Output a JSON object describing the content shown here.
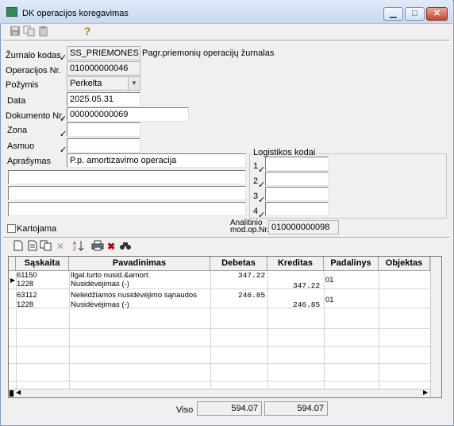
{
  "window": {
    "title": "DK operacijos koregavimas",
    "minimize_glyph": "▁",
    "maximize_glyph": "□",
    "close_glyph": "✕"
  },
  "toolbar": {
    "icons": [
      "save-icon",
      "copy-icon",
      "paste-icon",
      "help-icon"
    ],
    "help_glyph": "?"
  },
  "form": {
    "journal_code_label": "Žurnalo kodas",
    "journal_code_value": "SS_PRIEMONES",
    "journal_description": "Pagr.priemonių operacijų žurnalas",
    "operation_no_label": "Operacijos Nr.",
    "operation_no_value": "010000000046",
    "attribute_label": "Požymis",
    "attribute_value": "Perkelta",
    "date_label": "Data",
    "date_value": "2025.05.31",
    "document_no_label": "Dokumento Nr.",
    "document_no_value": "000000000069",
    "zone_label": "Zona",
    "zone_value": "",
    "person_label": "Asmuo",
    "person_value": "",
    "description_label": "Aprašymas",
    "description_value": "P.p. amortizavimo operacija",
    "description_lines": [
      "",
      "",
      ""
    ],
    "checkmark": "✓"
  },
  "logistics": {
    "title": "Logistikos kodai",
    "rows": [
      {
        "label": "1",
        "value": ""
      },
      {
        "label": "2",
        "value": ""
      },
      {
        "label": "3",
        "value": ""
      },
      {
        "label": "4",
        "value": ""
      }
    ]
  },
  "bottom_form": {
    "posted_label": "Kartojama",
    "analytic_label_line1": "Analitinio",
    "analytic_label_line2": "mod.op.Nr.",
    "analytic_value": "010000000098"
  },
  "grid_toolbar": {
    "icons": [
      "new-doc-icon",
      "doc-icon",
      "copy-rows-icon",
      "delete-icon",
      "sort-icon",
      "print-icon",
      "clear-icon",
      "find-icon"
    ]
  },
  "grid": {
    "columns": [
      "Sąskaita",
      "Pavadinimas",
      "Debetas",
      "Kreditas",
      "Padalinys",
      "Objektas"
    ],
    "rows": [
      {
        "account": "61150",
        "name": "Ilgal.turto nusid.&amort.",
        "debit": "347.22",
        "credit": "",
        "unit": "01"
      },
      {
        "account": "1228",
        "name": "Nusidėvėjimas (-)",
        "debit": "",
        "credit": "347.22",
        "unit": ""
      },
      {
        "account": "63112",
        "name": "Neleidžiamos nusidėvėjimo sąnaudos",
        "debit": "246.85",
        "credit": "",
        "unit": "01"
      },
      {
        "account": "1228",
        "name": "Nusidėvėjimas (-)",
        "debit": "",
        "credit": "246.85",
        "unit": ""
      }
    ]
  },
  "totals": {
    "label": "Viso",
    "debit": "594.07",
    "credit": "594.07"
  }
}
